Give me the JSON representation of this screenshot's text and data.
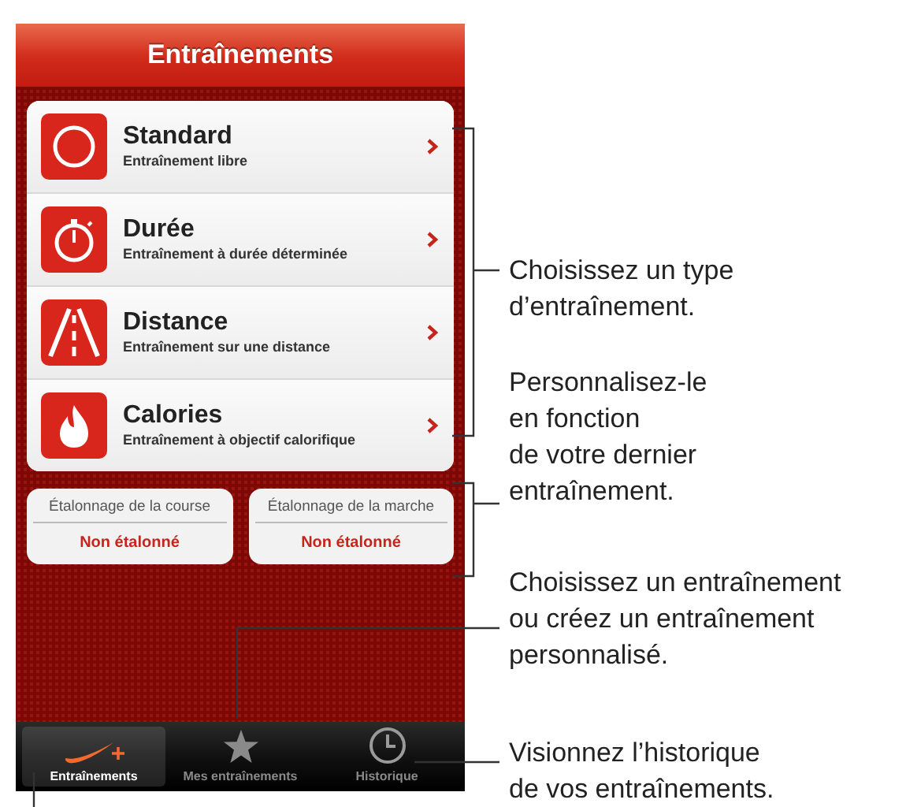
{
  "nav_bar": {
    "title": "Entraînements"
  },
  "workouts": [
    {
      "title": "Standard",
      "subtitle": "Entraînement libre"
    },
    {
      "title": "Durée",
      "subtitle": "Entraînement à durée déterminée"
    },
    {
      "title": "Distance",
      "subtitle": "Entraînement sur une distance"
    },
    {
      "title": "Calories",
      "subtitle": "Entraînement à objectif calorifique"
    }
  ],
  "calibrations": [
    {
      "label": "Étalonnage de la course",
      "value": "Non étalonné"
    },
    {
      "label": "Étalonnage de la marche",
      "value": "Non étalonné"
    }
  ],
  "tab_bar": [
    {
      "label": "Entraînements",
      "selected": true
    },
    {
      "label": "Mes entraînements",
      "selected": false
    },
    {
      "label": "Historique",
      "selected": false
    }
  ],
  "callouts": [
    {
      "text": "Choisissez un type\nd’entraînement."
    },
    {
      "text": "Personnalisez-le\nen fonction\nde votre dernier\nentraînement."
    },
    {
      "text": "Choisissez un entraînement\nou créez un entraînement\npersonnalisé."
    },
    {
      "text": "Visionnez l’historique\nde vos entraînements."
    }
  ]
}
